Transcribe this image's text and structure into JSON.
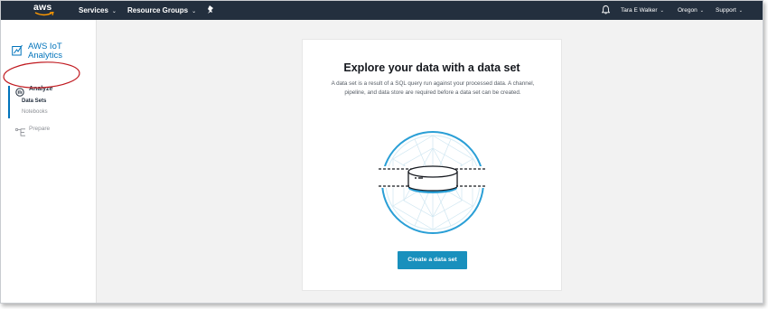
{
  "topnav": {
    "logo_text": "aws",
    "services_label": "Services",
    "resource_groups_label": "Resource Groups",
    "user_label": "Tara E Walker",
    "region_label": "Oregon",
    "support_label": "Support"
  },
  "sidebar": {
    "brand_line1": "AWS IoT",
    "brand_line2": "Analytics",
    "analyze_label": "Analyze",
    "datasets_label": "Data Sets",
    "notebooks_label": "Notebooks",
    "prepare_label": "Prepare"
  },
  "main": {
    "title": "Explore your data with a data set",
    "description": "A data set is a result of a SQL query run against your processed data. A channel, pipeline, and data store are required before a data set can be created.",
    "create_button_label": "Create a data set"
  },
  "colors": {
    "nav_bg": "#232f3e",
    "accent": "#0073bb",
    "button": "#1990bd",
    "annotation_red": "#c0191f"
  }
}
